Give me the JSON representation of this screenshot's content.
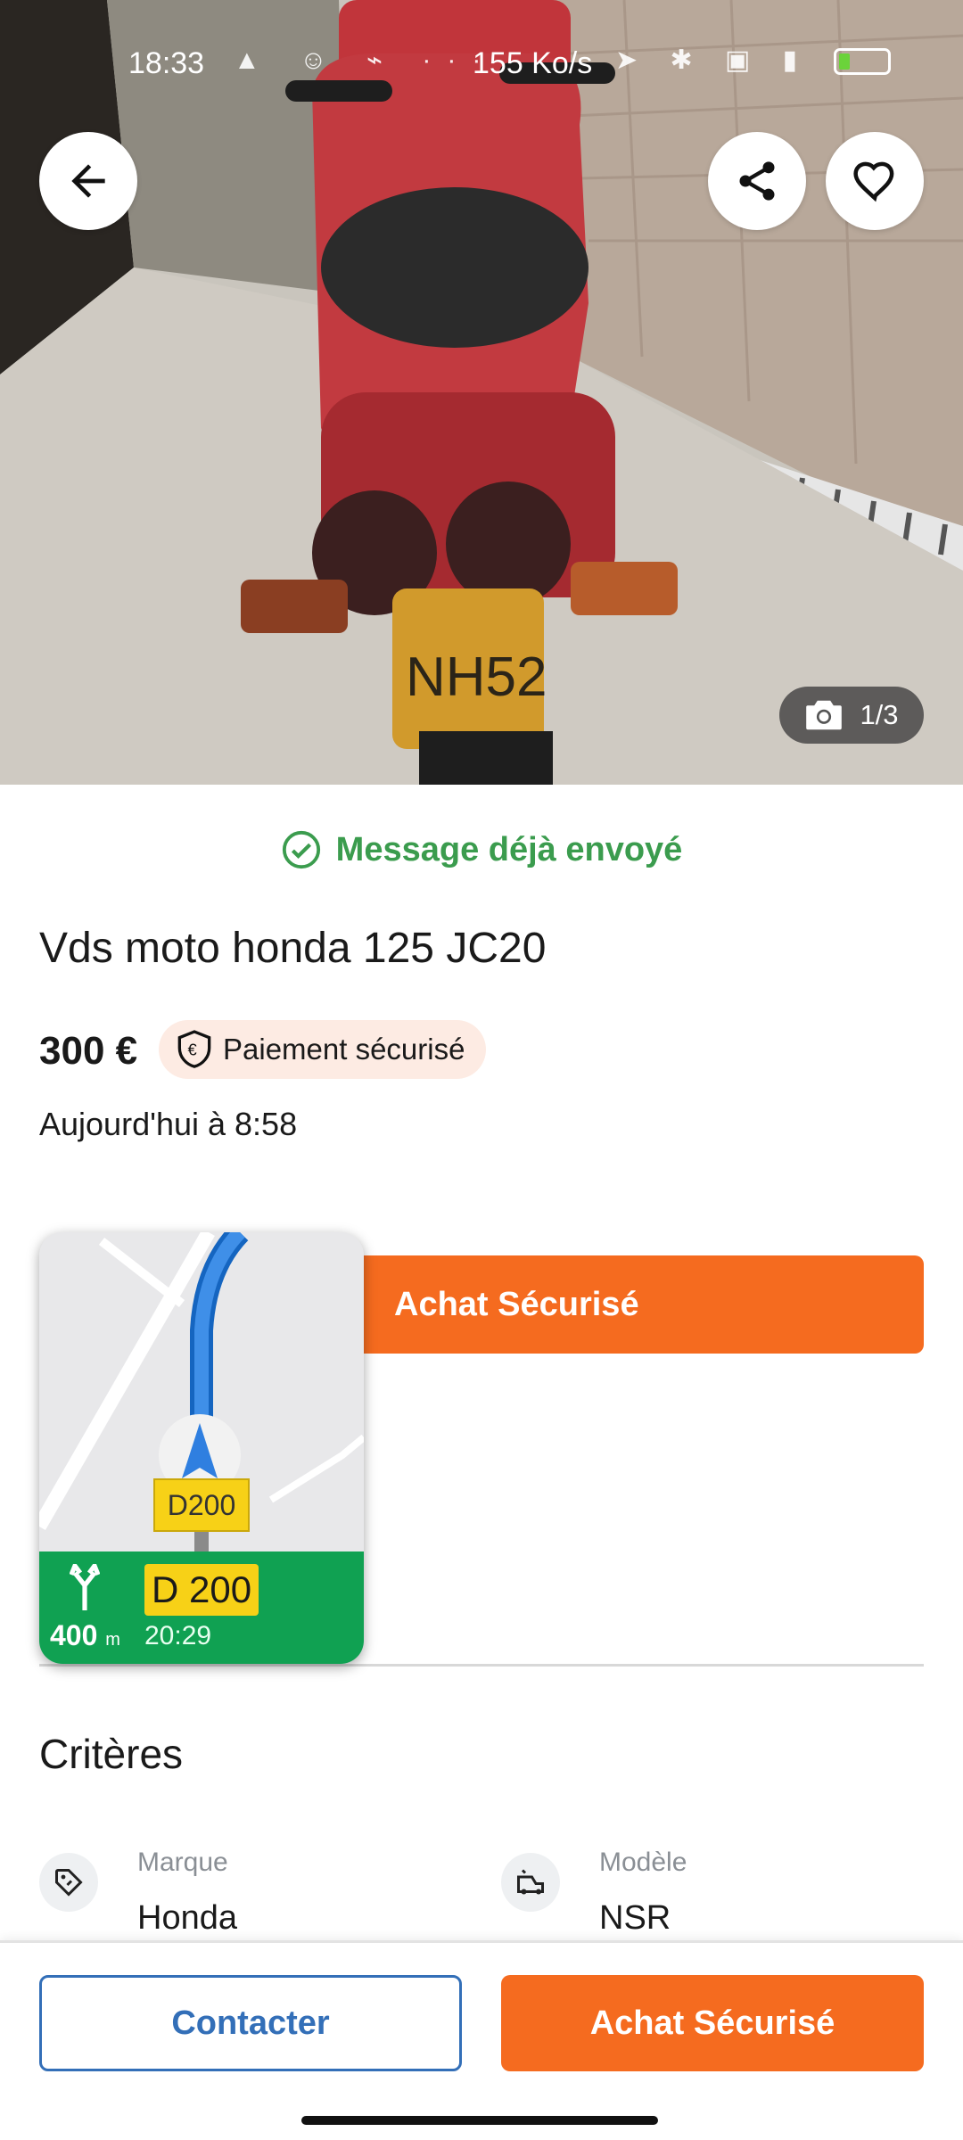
{
  "status_bar": {
    "time": "18:33",
    "speed": "155 Ko/s",
    "battery_color": "#6bd33a"
  },
  "hero": {
    "photo_counter": "1/3",
    "back_icon": "arrow-left-icon",
    "share_icon": "share-icon",
    "favorite_icon": "heart-icon",
    "camera_icon": "camera-icon"
  },
  "listing": {
    "message_status": "Message déjà envoyé",
    "title": "Vds moto honda 125 JC20",
    "price": "300 €",
    "secure_payment_label": "Paiement sécurisé",
    "date": "Aujourd'hui à 8:58",
    "achat_button": "Achat Sécurisé"
  },
  "navigation_overlay": {
    "map_road_label": "D200",
    "road": "D 200",
    "distance": "400",
    "distance_unit": "m",
    "eta": "20:29"
  },
  "criteres": {
    "heading": "Critères",
    "items": [
      {
        "label": "Marque",
        "value": "Honda",
        "icon": "tag-icon"
      },
      {
        "label": "Modèle",
        "value": "NSR",
        "icon": "car-icon"
      }
    ]
  },
  "bottom_bar": {
    "contact_label": "Contacter",
    "achat_label": "Achat Sécurisé"
  },
  "colors": {
    "accent_orange": "#f56b1f",
    "link_blue": "#336fb8",
    "success_green": "#3b9c4e",
    "nav_green": "#10a152"
  }
}
